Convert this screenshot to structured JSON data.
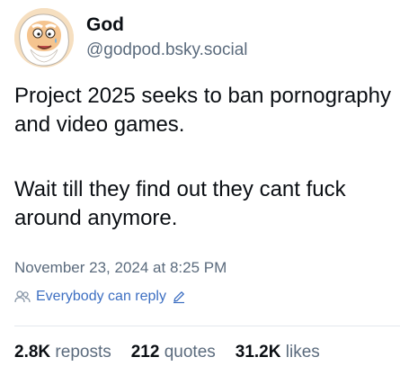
{
  "author": {
    "display_name": "God",
    "handle": "@godpod.bsky.social",
    "avatar_icon": "cartoon-god-face-icon"
  },
  "post": {
    "paragraphs": [
      "Project 2025 seeks to ban pornography and video games.",
      "Wait till they find out they cant fuck around anymore."
    ],
    "timestamp": "November 23, 2024 at 8:25 PM"
  },
  "reply_setting": {
    "label": "Everybody can reply",
    "icon": "people-icon",
    "edit_icon": "pencil-icon"
  },
  "stats": {
    "reposts": {
      "count": "2.8K",
      "label": "reposts"
    },
    "quotes": {
      "count": "212",
      "label": "quotes"
    },
    "likes": {
      "count": "31.2K",
      "label": "likes"
    }
  },
  "colors": {
    "text": "#0b0f14",
    "muted": "#5b6b7d",
    "link": "#3d6fc2",
    "divider": "#e3e8ee"
  }
}
